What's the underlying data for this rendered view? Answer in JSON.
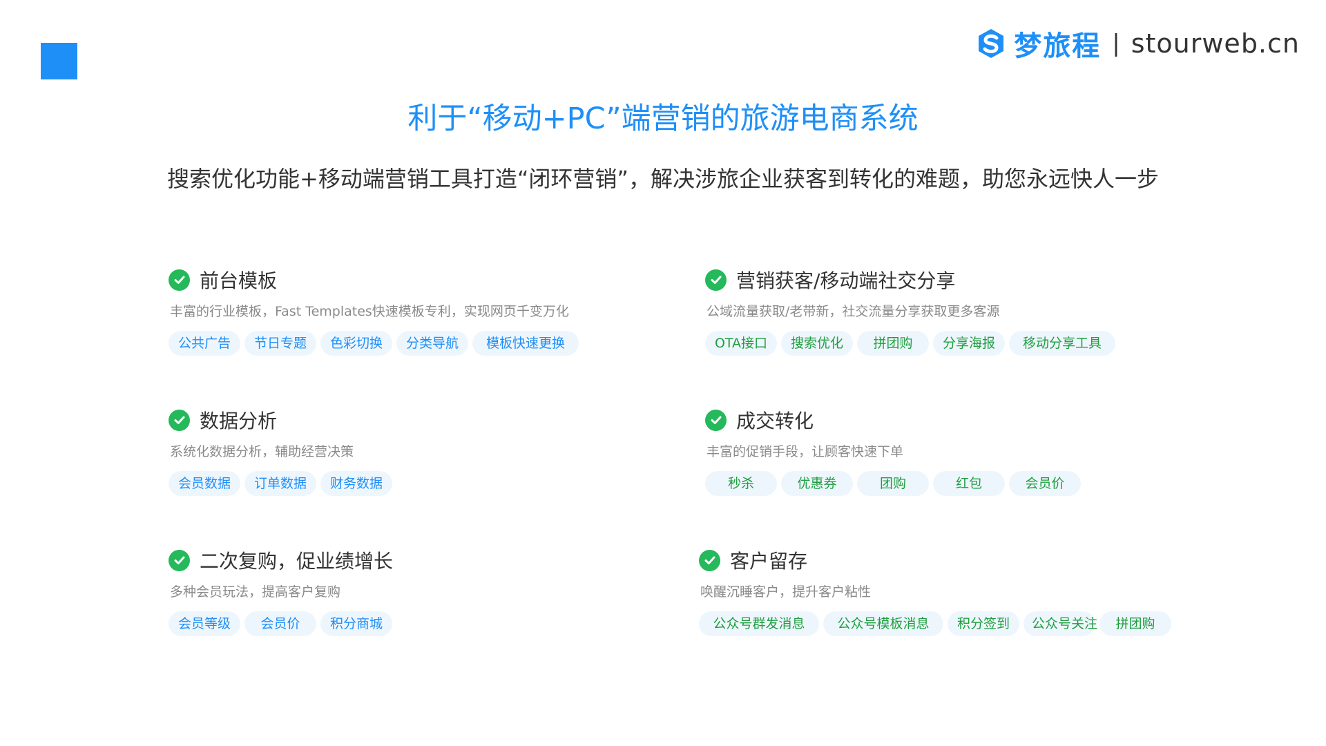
{
  "brand": {
    "name": "梦旅程",
    "separator": "|",
    "url": "stourweb.cn",
    "color": "#1e8ff7"
  },
  "headline": "利于“移动+PC”端营销的旅游电商系统",
  "subline": "搜索优化功能+移动端营销工具打造“闭环营销”，解决涉旅企业获客到转化的难题，助您永远快人一步",
  "colors": {
    "accent": "#1e8ff7",
    "check": "#24b95a",
    "tag_bg": "#eef6fd",
    "tag_green_text": "#1f9e3f"
  },
  "features": [
    {
      "title": "前台模板",
      "desc": "丰富的行业模板，Fast Templates快速模板专利，实现网页千变万化",
      "tags": [
        "公共广告",
        "节日专题",
        "色彩切换",
        "分类导航",
        "模板快速更换"
      ]
    },
    {
      "title": "营销获客/移动端社交分享",
      "desc": "公域流量获取/老带新，社交流量分享获取更多客源",
      "tags": [
        "OTA接口",
        "搜索优化",
        "拼团购",
        "分享海报",
        "移动分享工具"
      ]
    },
    {
      "title": "数据分析",
      "desc": "系统化数据分析，辅助经营决策",
      "tags": [
        "会员数据",
        "订单数据",
        "财务数据"
      ]
    },
    {
      "title": "成交转化",
      "desc": "丰富的促销手段，让顾客快速下单",
      "tags": [
        "秒杀",
        "优惠券",
        "团购",
        "红包",
        "会员价"
      ]
    },
    {
      "title": "二次复购，促业绩增长",
      "desc": "多种会员玩法，提高客户复购",
      "tags": [
        "会员等级",
        "会员价",
        "积分商城"
      ]
    },
    {
      "title": "客户留存",
      "desc": "唤醒沉睡客户，提升客户粘性",
      "tags": [
        "公众号群发消息",
        "公众号模板消息",
        "积分签到",
        "公众号关注",
        "拼团购"
      ]
    }
  ]
}
